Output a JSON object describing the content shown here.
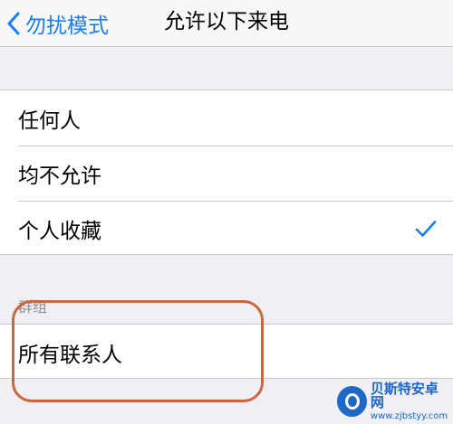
{
  "navbar": {
    "back_label": "勿扰模式",
    "title": "允许以下来电"
  },
  "options": [
    {
      "label": "任何人",
      "selected": false
    },
    {
      "label": "均不允许",
      "selected": false
    },
    {
      "label": "个人收藏",
      "selected": true
    }
  ],
  "groups_section": {
    "header": "群组",
    "items": [
      {
        "label": "所有联系人"
      }
    ]
  },
  "watermark": {
    "name": "贝斯特安卓网",
    "url": "www.zjbstyy.com"
  },
  "colors": {
    "accent": "#157efb",
    "highlight": "#c8683e",
    "background": "#efeff4"
  }
}
